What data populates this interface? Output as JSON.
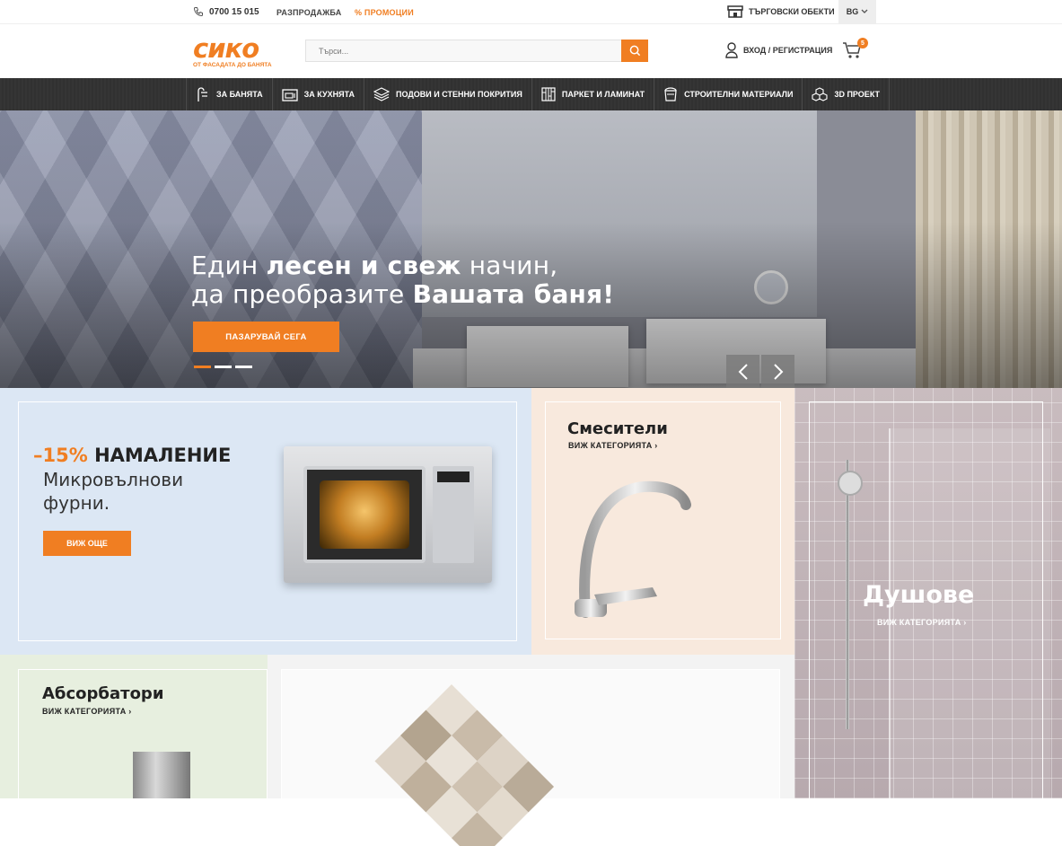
{
  "topbar": {
    "phone": "0700 15 015",
    "sale": "РАЗПРОДАЖБА",
    "promo": "% ПРОМОЦИИ",
    "stores": "ТЪРГОВСКИ ОБЕКТИ",
    "lang": "BG"
  },
  "header": {
    "logo_word": "сико",
    "logo_tagline": "ОТ ФАСАДАТА ДО БАНЯТА",
    "search_placeholder": "Търси...",
    "login": "ВХОД / РЕГИСТРАЦИЯ",
    "cart_count": "5"
  },
  "nav": {
    "items": [
      {
        "label": "ЗА БАНЯТА",
        "icon": "shower-icon"
      },
      {
        "label": "ЗА КУХНЯТА",
        "icon": "kitchen-icon"
      },
      {
        "label": "ПОДОВИ И СТЕННИ ПОКРИТИЯ",
        "icon": "layers-icon"
      },
      {
        "label": "ПАРКЕТ И ЛАМИНАТ",
        "icon": "parquet-icon"
      },
      {
        "label": "СТРОИТЕЛНИ МАТЕРИАЛИ",
        "icon": "bucket-icon"
      },
      {
        "label": "3D ПРОЕКТ",
        "icon": "cubes-icon"
      }
    ]
  },
  "hero": {
    "line1_a": "Един ",
    "line1_b": "лесен и свеж",
    "line1_c": " начин,",
    "line2_a": "да преобразите ",
    "line2_b": "Вашата баня!",
    "cta": "ПАЗАРУВАЙ СЕГА",
    "slides_total": 3,
    "slide_active": 1
  },
  "promo_microwave": {
    "pct": "–15%",
    "title": " НАМАЛЕНИЕ",
    "subtitle": "Микровълнови фурни.",
    "button": "ВИЖ ОЩЕ"
  },
  "cat_faucets": {
    "title": "Смесители",
    "link": "ВИЖ КАТЕГОРИЯТА ›"
  },
  "cat_showers": {
    "title": "Душове",
    "link": "ВИЖ КАТЕГОРИЯТА ›"
  },
  "cat_hoods": {
    "title": "Абсорбатори",
    "link": "ВИЖ КАТЕГОРИЯТА ›"
  },
  "colors": {
    "accent": "#f07e22",
    "nav_bg": "#333333"
  }
}
